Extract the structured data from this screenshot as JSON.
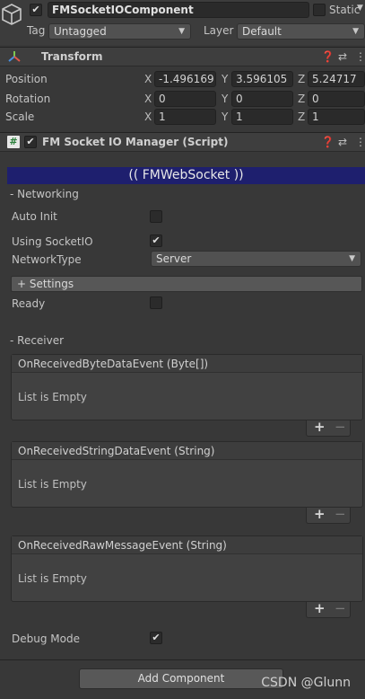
{
  "gameobject": {
    "name": "FMSocketIOComponent",
    "static_label": "Static",
    "tag_label": "Tag",
    "tag_value": "Untagged",
    "layer_label": "Layer",
    "layer_value": "Default"
  },
  "transform": {
    "title": "Transform",
    "rows": [
      {
        "label": "Position",
        "x": "-1.496169",
        "y": "3.596105",
        "z": "5.24717"
      },
      {
        "label": "Rotation",
        "x": "0",
        "y": "0",
        "z": "0"
      },
      {
        "label": "Scale",
        "x": "1",
        "y": "1",
        "z": "1"
      }
    ],
    "axis_x": "X",
    "axis_y": "Y",
    "axis_z": "Z"
  },
  "script": {
    "title": "FM Socket IO Manager (Script)",
    "banner": "(( FMWebSocket ))",
    "networking_header": "- Networking",
    "auto_init_label": "Auto Init",
    "using_socketio_label": "Using SocketIO",
    "network_type_label": "NetworkType",
    "network_type_value": "Server",
    "settings_label": "+ Settings",
    "ready_label": "Ready",
    "receiver_header": "- Receiver",
    "events": [
      {
        "title": "OnReceivedByteDataEvent (Byte[])",
        "empty": "List is Empty"
      },
      {
        "title": "OnReceivedStringDataEvent (String)",
        "empty": "List is Empty"
      },
      {
        "title": "OnReceivedRawMessageEvent (String)",
        "empty": "List is Empty"
      }
    ],
    "debug_mode_label": "Debug Mode",
    "checks": {
      "auto_init": false,
      "using_socketio": true,
      "ready": false,
      "debug_mode": true
    }
  },
  "add_component_label": "Add Component",
  "plus_symbol": "+",
  "minus_symbol": "−",
  "checkmark": "✔",
  "watermark": "CSDN @Glunn",
  "colors": {
    "banner": "#1e1f6e",
    "panel": "#383838",
    "field": "#2a2a2a"
  }
}
